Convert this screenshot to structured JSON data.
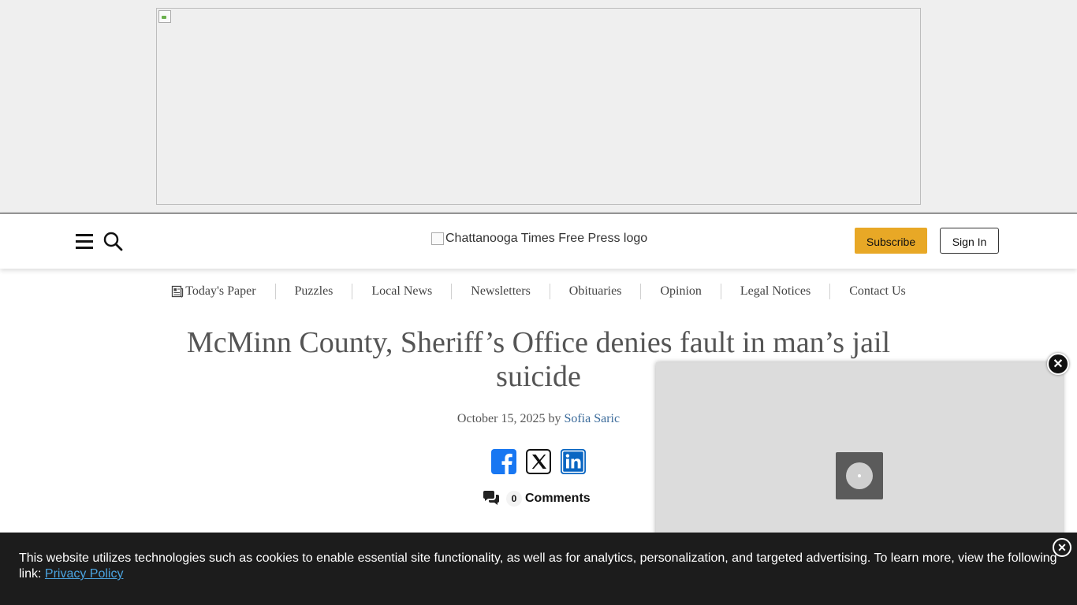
{
  "header": {
    "logo_alt": "Chattanooga Times Free Press logo",
    "subscribe_label": "Subscribe",
    "signin_label": "Sign In"
  },
  "nav": {
    "items": [
      {
        "label": "Today's Paper"
      },
      {
        "label": "Puzzles"
      },
      {
        "label": "Local News"
      },
      {
        "label": "Newsletters"
      },
      {
        "label": "Obituaries"
      },
      {
        "label": "Opinion"
      },
      {
        "label": "Legal Notices"
      },
      {
        "label": "Contact Us"
      }
    ]
  },
  "article": {
    "headline": "McMinn County, Sheriff’s Office denies fault in man’s jail suicide",
    "date": "October 15, 2025",
    "by": "by",
    "author": "Sofia Saric",
    "comments_count": "0",
    "comments_label": "Comments"
  },
  "cookie": {
    "text": "This website utilizes technologies such as cookies to enable essential site functionality, as well as for analytics, personalization, and targeted advertising. To learn more, view the following link: ",
    "link_label": "Privacy Policy"
  },
  "colors": {
    "subscribe_bg": "#e8a826",
    "author_link": "#3a6a9a",
    "cookie_bg": "#1c1c1c",
    "cookie_link": "#4aa3df",
    "facebook": "#1877f2",
    "linkedin": "#0a66c2"
  }
}
